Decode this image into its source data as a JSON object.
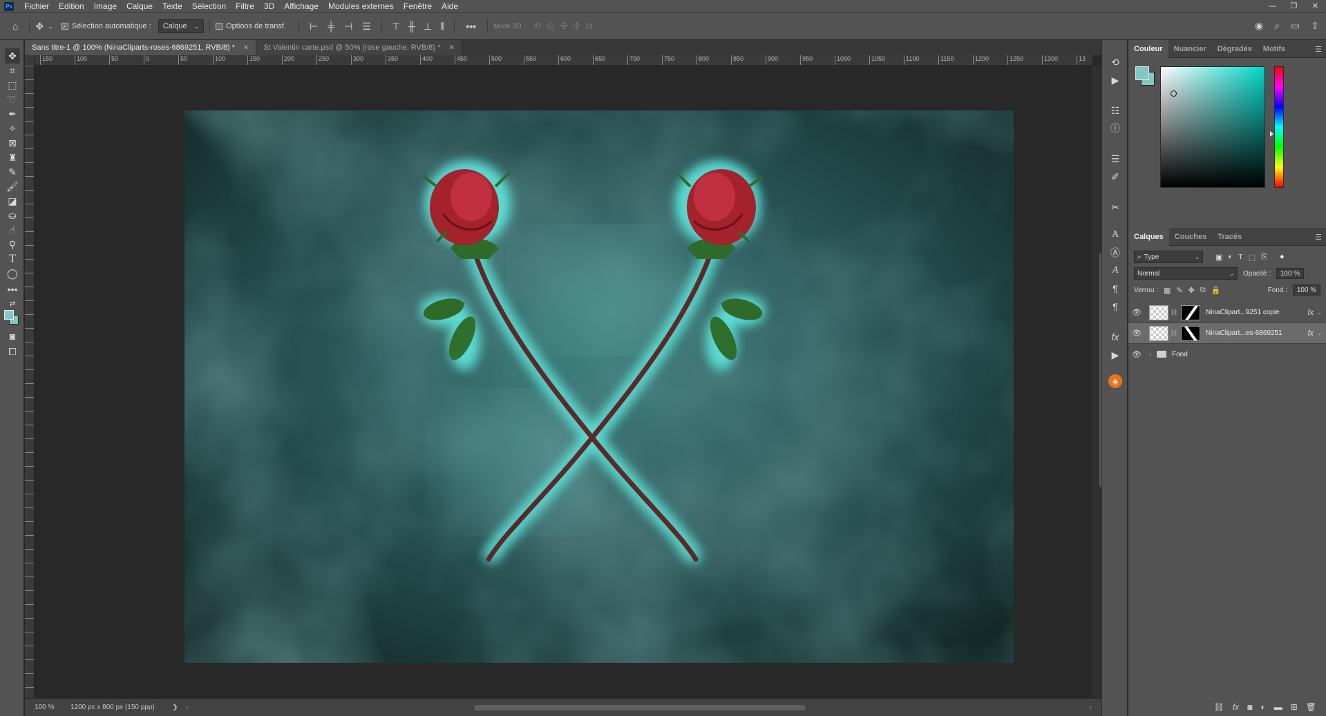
{
  "app": {
    "logo": "Ps"
  },
  "menu": [
    "Fichier",
    "Edition",
    "Image",
    "Calque",
    "Texte",
    "Sélection",
    "Filtre",
    "3D",
    "Affichage",
    "Modules externes",
    "Fenêtre",
    "Aide"
  ],
  "window_controls": [
    "—",
    "❐",
    "✕"
  ],
  "options": {
    "auto_select_label": "Sélection automatique :",
    "auto_select_target": "Calque",
    "transform_label": "Options de transf.",
    "mode3d_label": "Mode 3D :"
  },
  "tabs": [
    {
      "label": "Sans titre-1 @ 100% (NinaCliparts-roses-6869251, RVB/8) *",
      "active": true
    },
    {
      "label": "St Valentin carte.psd @ 50% (rose gauche, RVB/8) *",
      "active": false
    }
  ],
  "ruler_labels": [
    "150",
    "100",
    "50",
    "0",
    "50",
    "100",
    "150",
    "200",
    "250",
    "300",
    "350",
    "400",
    "450",
    "500",
    "550",
    "600",
    "650",
    "700",
    "750",
    "800",
    "850",
    "900",
    "950",
    "1000",
    "1050",
    "1100",
    "1150",
    "1200",
    "1250",
    "1300",
    "13"
  ],
  "status": {
    "zoom": "100 %",
    "doc_info": "1200 px x 800 px (150 ppp)",
    "arrow": "❯"
  },
  "color_panel": {
    "tabs": [
      "Couleur",
      "Nuancier",
      "Dégradés",
      "Motifs"
    ],
    "foreground": "#83c8c4"
  },
  "layers_panel": {
    "tabs": [
      "Calques",
      "Couches",
      "Tracés"
    ],
    "filter_label": "Type",
    "blend_mode": "Normal",
    "opacity_label": "Opacité :",
    "opacity_value": "100 %",
    "lock_label": "Verrou :",
    "fill_label": "Fond :",
    "fill_value": "100 %",
    "layers": [
      {
        "name": "NinaClipart...9251 copie",
        "fx": "fx",
        "selected": false
      },
      {
        "name": "NinaClipart...es-6869251",
        "fx": "fx",
        "selected": true
      },
      {
        "name": "Fond",
        "type": "group"
      }
    ]
  },
  "canvas": {
    "background": "#203f40",
    "glow": "#5ee6dd",
    "stem": "#5b2a27",
    "rose": "#b0242e",
    "leaf": "#2e6b2a"
  }
}
